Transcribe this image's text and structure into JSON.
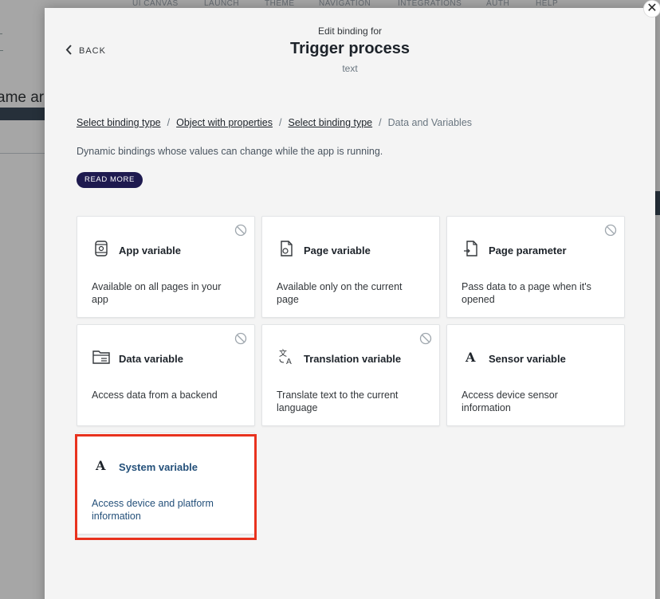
{
  "background": {
    "nav_tabs": [
      "UI CANVAS",
      "LAUNCH",
      "THEME",
      "NAVIGATION",
      "INTEGRATIONS",
      "AUTH",
      "HELP"
    ],
    "title_fragment": "ame ar"
  },
  "modal": {
    "back_label": "BACK",
    "subtitle": "Edit binding for",
    "title": "Trigger process",
    "kind": "text",
    "close_icon": "close-icon",
    "breadcrumb": [
      {
        "label": "Select binding type",
        "link": true
      },
      {
        "label": "Object with properties",
        "link": true
      },
      {
        "label": "Select binding type",
        "link": true
      },
      {
        "label": "Data and Variables",
        "link": false
      }
    ],
    "separator": "/",
    "description": "Dynamic bindings whose values can change while the app is running.",
    "read_more": "READ MORE",
    "cards": [
      {
        "title": "App variable",
        "description": "Available on all pages in your app",
        "icon": "app-variable-icon",
        "disabled": true
      },
      {
        "title": "Page variable",
        "description": "Available only on the current page",
        "icon": "page-variable-icon",
        "disabled": false
      },
      {
        "title": "Page parameter",
        "description": "Pass data to a page when it's opened",
        "icon": "page-parameter-icon",
        "disabled": true
      },
      {
        "title": "Data variable",
        "description": "Access data from a backend",
        "icon": "data-variable-icon",
        "disabled": true
      },
      {
        "title": "Translation variable",
        "description": "Translate text to the current language",
        "icon": "translation-icon",
        "disabled": true
      },
      {
        "title": "Sensor variable",
        "description": "Access device sensor information",
        "icon": "sensor-variable-icon",
        "disabled": false
      },
      {
        "title": "System variable",
        "description": "Access device and platform information",
        "icon": "system-variable-icon",
        "disabled": false,
        "selected": true
      }
    ],
    "highlight_color": "#e8321e",
    "accent_color": "#1e1a4f"
  }
}
